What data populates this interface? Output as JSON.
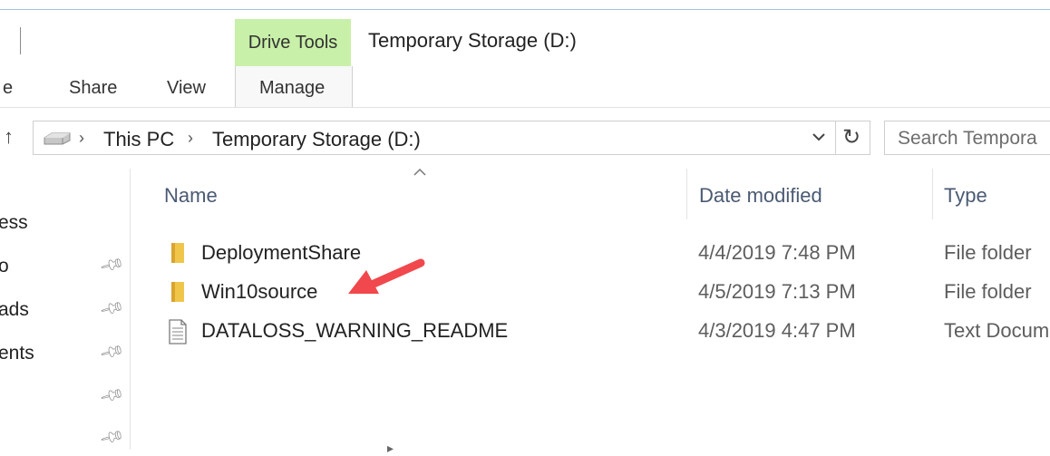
{
  "window": {
    "title": "Temporary Storage (D:)",
    "context_tab": "Drive Tools"
  },
  "ribbon": {
    "tabs": [
      {
        "label": "e"
      },
      {
        "label": "Share"
      },
      {
        "label": "View"
      },
      {
        "label": "Manage"
      }
    ]
  },
  "address": {
    "crumbs": [
      "This PC",
      "Temporary Storage (D:)"
    ],
    "dropdown_icon": "chevron-down-icon",
    "refresh_icon": "refresh-icon"
  },
  "search": {
    "placeholder": "Search Tempora"
  },
  "nav": {
    "items": [
      {
        "label": "ess",
        "pinned": false
      },
      {
        "label": "o",
        "pinned": true
      },
      {
        "label": "ads",
        "pinned": true
      },
      {
        "label": "ents",
        "pinned": true
      },
      {
        "label": "",
        "pinned": true
      },
      {
        "label": "",
        "pinned": true
      }
    ]
  },
  "columns": {
    "name": "Name",
    "date": "Date modified",
    "type": "Type"
  },
  "files": [
    {
      "name": "DeploymentShare",
      "date": "4/4/2019 7:48 PM",
      "type": "File folder",
      "icon": "folder-icon"
    },
    {
      "name": "Win10source",
      "date": "4/5/2019 7:13 PM",
      "type": "File folder",
      "icon": "folder-icon"
    },
    {
      "name": "DATALOSS_WARNING_README",
      "date": "4/3/2019 4:47 PM",
      "type": "Text Docum",
      "icon": "text-file-icon"
    }
  ],
  "colors": {
    "drive_tools_bg": "#c8f0a8",
    "annotation_arrow": "#f0484c",
    "folder": "#f0c64a"
  }
}
